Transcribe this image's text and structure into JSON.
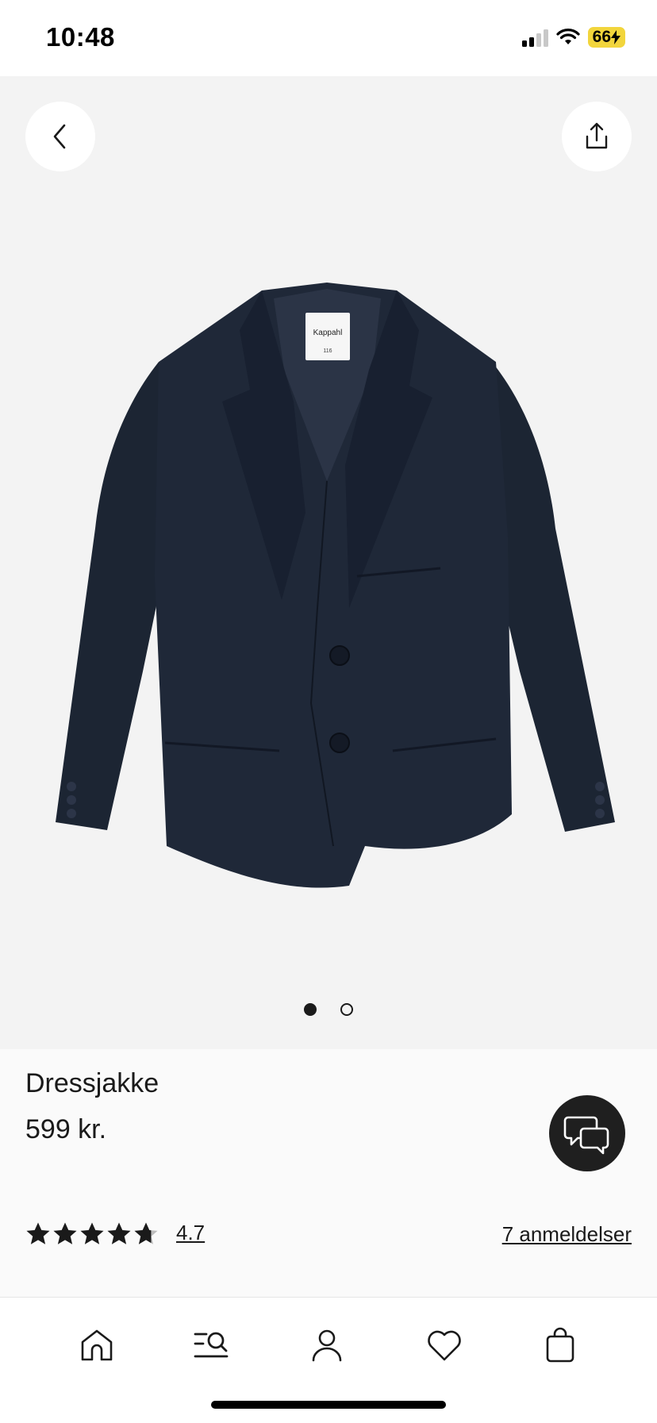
{
  "status_bar": {
    "time": "10:48",
    "battery": "66"
  },
  "hero": {
    "back_icon": "chevron-left-icon",
    "share_icon": "share-icon",
    "label_brand": "Kappahl",
    "label_size": "116",
    "pagination": {
      "count": 2,
      "active": 1
    }
  },
  "product": {
    "title": "Dressjakke",
    "price": "599 kr.",
    "rating": {
      "value": "4.7",
      "stars": 4.7,
      "max": 5
    },
    "reviews_label": "7 anmeldelser",
    "chat_icon": "chat-bubbles-icon"
  },
  "tabbar": {
    "items": [
      "home-icon",
      "search-menu-icon",
      "profile-icon",
      "heart-icon",
      "bag-icon"
    ]
  },
  "colors": {
    "jacket": "#1c2533",
    "hero_bg": "#f3f3f3",
    "fab": "#1f1f1f",
    "battery": "#f2d53c"
  }
}
